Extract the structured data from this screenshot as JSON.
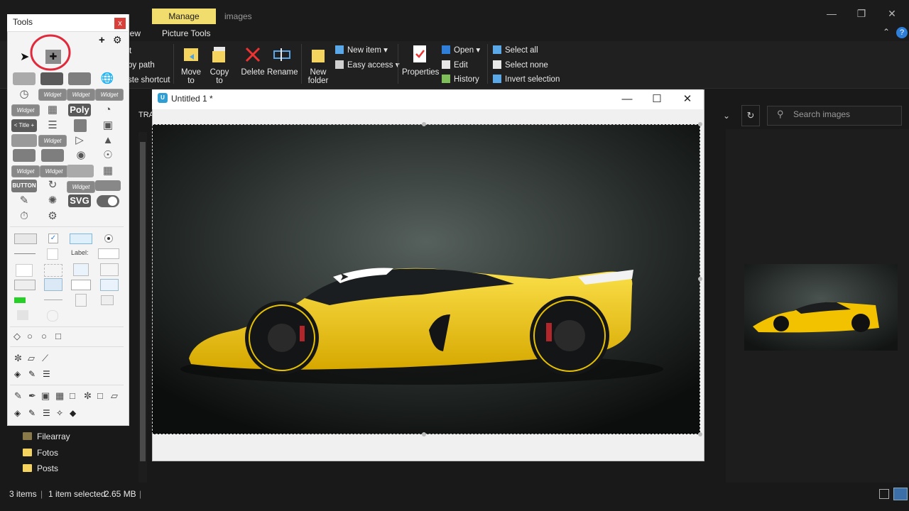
{
  "explorer": {
    "manage_tab": "Manage",
    "title": "images",
    "ribbon_tabs": [
      "iew",
      "Picture Tools"
    ],
    "clipboard_partial": [
      "t",
      "py path",
      "ste shortcut"
    ],
    "organize": {
      "move_to": "Move\nto",
      "copy_to": "Copy\nto",
      "delete": "Delete",
      "rename": "Rename"
    },
    "new_folder": "New\nfolder",
    "new_item": "New item",
    "easy_access": "Easy access",
    "properties": "Properties",
    "open": "Open",
    "edit": "Edit",
    "history": "History",
    "select_all": "Select all",
    "select_none": "Select none",
    "invert_selection": "Invert selection",
    "address_partial": "TRA",
    "search_placeholder": "Search images",
    "tree": [
      "Filearray",
      "Fotos",
      "Posts"
    ],
    "status": {
      "items": "3 items",
      "selected": "1 item selected",
      "size": "2.65 MB"
    }
  },
  "tools": {
    "title": "Tools",
    "close": "x",
    "widget_label": "Widget",
    "poly_label": "Poly",
    "svg_label": "SVG",
    "title_label": "< Title +",
    "button_label": "BUTTON",
    "label_text": "Label:"
  },
  "untitled": {
    "title": "Untitled 1 *",
    "logo": "U"
  },
  "colors": {
    "manage": "#f1dc6e",
    "car_yellow": "#f2c200",
    "annotation_red": "#e0293a"
  }
}
